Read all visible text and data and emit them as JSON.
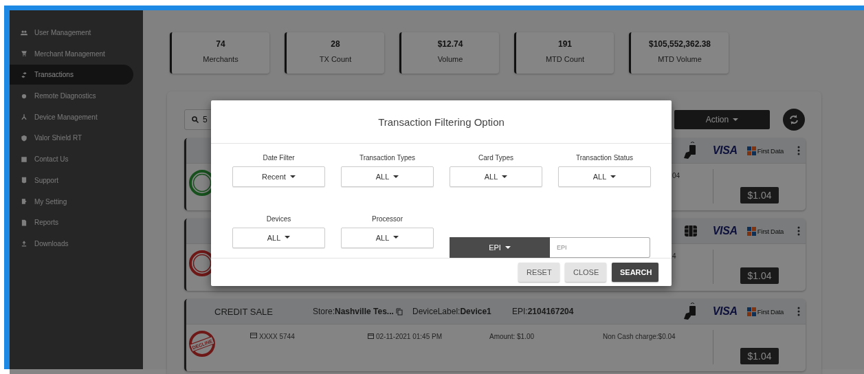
{
  "sidebar": {
    "items": [
      {
        "label": "User Management",
        "selected": false
      },
      {
        "label": "Merchant Management",
        "selected": false
      },
      {
        "label": "Transactions",
        "selected": true
      },
      {
        "label": "Remote Diagnostics",
        "selected": false
      },
      {
        "label": "Device Management",
        "selected": false
      },
      {
        "label": "Valor Shield RT",
        "selected": false
      },
      {
        "label": "Contact Us",
        "selected": false
      },
      {
        "label": "Support",
        "selected": false
      },
      {
        "label": "My Setting",
        "selected": false
      },
      {
        "label": "Reports",
        "selected": false
      },
      {
        "label": "Downloads",
        "selected": false
      }
    ]
  },
  "stats": [
    {
      "value": "74",
      "label": "Merchants"
    },
    {
      "value": "28",
      "label": "TX Count"
    },
    {
      "value": "$12.74",
      "label": "Volume"
    },
    {
      "value": "191",
      "label": "MTD Count"
    },
    {
      "value": "$105,552,362.38",
      "label": "MTD Volume"
    }
  ],
  "search": {
    "value": "5"
  },
  "action_button": {
    "label": "Action"
  },
  "transactions": [
    {
      "kind": "tap",
      "color": "#18511e",
      "card_brand": "VISA",
      "processor": "First Data",
      "non_cash_charge": "04",
      "amount": "$1.04"
    },
    {
      "kind": "chip",
      "color": "#6e1818",
      "card_brand": "VISA",
      "processor": "First Data",
      "non_cash_charge": "4",
      "amount": "$1.04"
    },
    {
      "kind": "tap",
      "color": "#6e1818",
      "stamp_text": "DECLINE",
      "type": "CREDIT SALE",
      "store_label": "Store:",
      "store": "Nashville Tes...",
      "device_label": "DeviceLabel:",
      "device": "Device1",
      "epi_label": "EPI:",
      "epi": "2104167204",
      "card_brand": "VISA",
      "processor": "First Data",
      "card": "XXXX 5744",
      "date": "02-11-2021 01:45 PM",
      "amount_text": "Amount: $1.00",
      "non_cash_charge": "Non Cash charge:$0.04",
      "amount": "$1.04"
    }
  ],
  "dialog": {
    "title": "Transaction Filtering Option",
    "filters": [
      {
        "label": "Date Filter",
        "value": "Recent"
      },
      {
        "label": "Transaction Types",
        "value": "ALL"
      },
      {
        "label": "Card Types",
        "value": "ALL"
      },
      {
        "label": "Transaction Status",
        "value": "ALL"
      },
      {
        "label": "Devices",
        "value": "ALL"
      },
      {
        "label": "Processor",
        "value": "ALL"
      }
    ],
    "id_search": {
      "type": "EPI",
      "placeholder": "EPI"
    },
    "buttons": [
      {
        "label": "RESET",
        "kind": "secondary"
      },
      {
        "label": "CLOSE",
        "kind": "secondary"
      },
      {
        "label": "SEARCH",
        "kind": "primary"
      }
    ]
  }
}
